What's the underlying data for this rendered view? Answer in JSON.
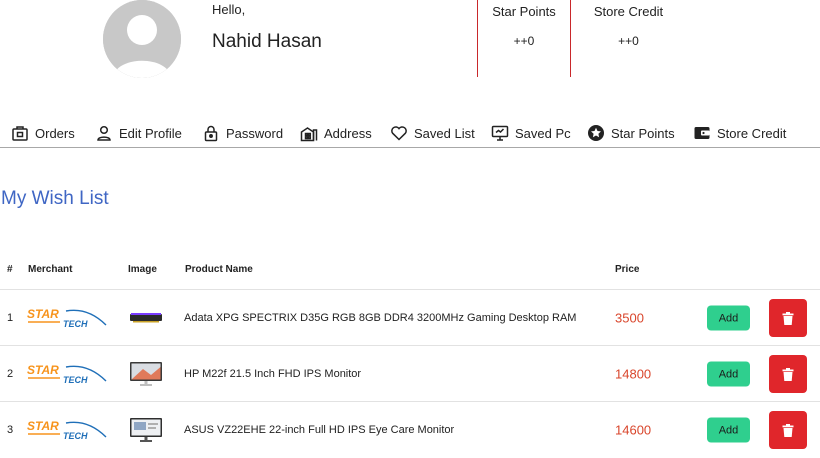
{
  "profile": {
    "greeting": "Hello,",
    "name": "Nahid Hasan"
  },
  "stats": [
    {
      "title": "Star Points",
      "value": "++0"
    },
    {
      "title": "Store Credit",
      "value": "++0"
    }
  ],
  "tabs": [
    {
      "label": "Orders",
      "icon": "orders-icon"
    },
    {
      "label": "Edit Profile",
      "icon": "user-icon"
    },
    {
      "label": "Password",
      "icon": "lock-icon"
    },
    {
      "label": "Address",
      "icon": "building-icon"
    },
    {
      "label": "Saved List",
      "icon": "heart-icon"
    },
    {
      "label": "Saved Pc",
      "icon": "monitor-icon"
    },
    {
      "label": "Star Points",
      "icon": "star-icon"
    },
    {
      "label": "Store Credit",
      "icon": "wallet-icon"
    }
  ],
  "wishlist": {
    "title": "My Wish List",
    "columns": [
      "#",
      "Merchant",
      "Image",
      "Product Name",
      "Price"
    ],
    "rows": [
      {
        "index": "1",
        "merchant": "Star Tech",
        "product_name": "Adata XPG SPECTRIX D35G RGB 8GB DDR4 3200MHz Gaming Desktop RAM",
        "price": "3500",
        "add_label": "Add",
        "image_icon": "ram-icon"
      },
      {
        "index": "2",
        "merchant": "Star Tech",
        "product_name": "HP M22f 21.5 Inch FHD IPS Monitor",
        "price": "14800",
        "add_label": "Add",
        "image_icon": "monitor-icon"
      },
      {
        "index": "3",
        "merchant": "Star Tech",
        "product_name": "ASUS VZ22EHE 22-inch Full HD IPS Eye Care Monitor",
        "price": "14600",
        "add_label": "Add",
        "image_icon": "monitor-icon"
      }
    ]
  },
  "colors": {
    "accent_blue": "#3f66c4",
    "price_red": "#d9452b",
    "add_green": "#2fcf8e",
    "delete_red": "#e0262b",
    "divider_red": "#c9282b",
    "logo_orange": "#f7941d",
    "logo_blue": "#1f6fb8"
  }
}
